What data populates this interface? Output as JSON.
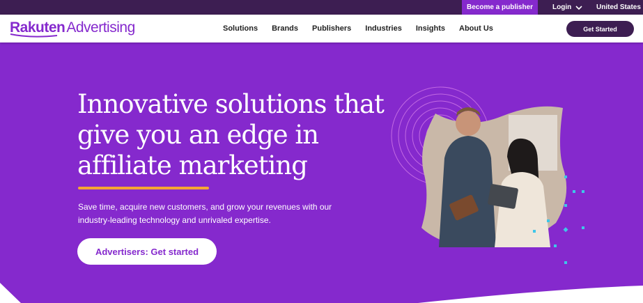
{
  "topbar": {
    "publisher_link": "Become a publisher",
    "login_label": "Login",
    "region_label": "United States"
  },
  "header": {
    "logo_brand": "Rakuten",
    "logo_product": "Advertising",
    "nav": [
      "Solutions",
      "Brands",
      "Publishers",
      "Industries",
      "Insights",
      "About Us"
    ],
    "cta_label": "Get Started"
  },
  "hero": {
    "title": "Innovative solutions that give you an edge in affiliate marketing",
    "subtitle": "Save time, acquire new customers, and grow your revenues with our industry-leading technology and unrivaled expertise.",
    "button_label": "Advertisers: Get started"
  },
  "colors": {
    "brand_purple": "#8529cd",
    "dark_purple": "#3d1e52",
    "accent_orange": "#f6a633",
    "accent_cyan": "#3fc6e8"
  },
  "icons": {
    "login_chevron": "chevron-down-icon"
  }
}
